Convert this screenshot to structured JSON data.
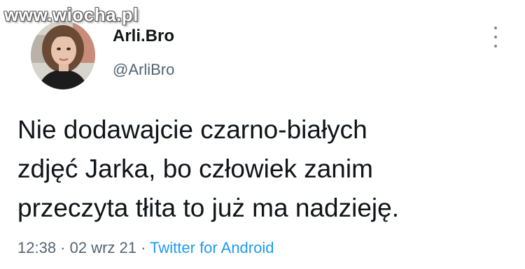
{
  "watermark": {
    "text": "www.wiocha.pl"
  },
  "tweet": {
    "author": {
      "display_name": "Arli.Bro",
      "handle": "@ArliBro"
    },
    "text_lines": [
      "Nie dodawajcie czarno-białych",
      "zdjęć Jarka, bo człowiek zanim",
      "przeczyta tłita to już ma nadzieję."
    ],
    "meta": {
      "time": "12:38",
      "separator": " · ",
      "date": "02 wrz 21",
      "source": "Twitter for Android"
    }
  },
  "icons": {
    "more_menu": "more-vertical-icon"
  },
  "colors": {
    "text": "#0f1419",
    "secondary": "#536471",
    "link": "#1d9bf0",
    "background": "#ffffff"
  }
}
